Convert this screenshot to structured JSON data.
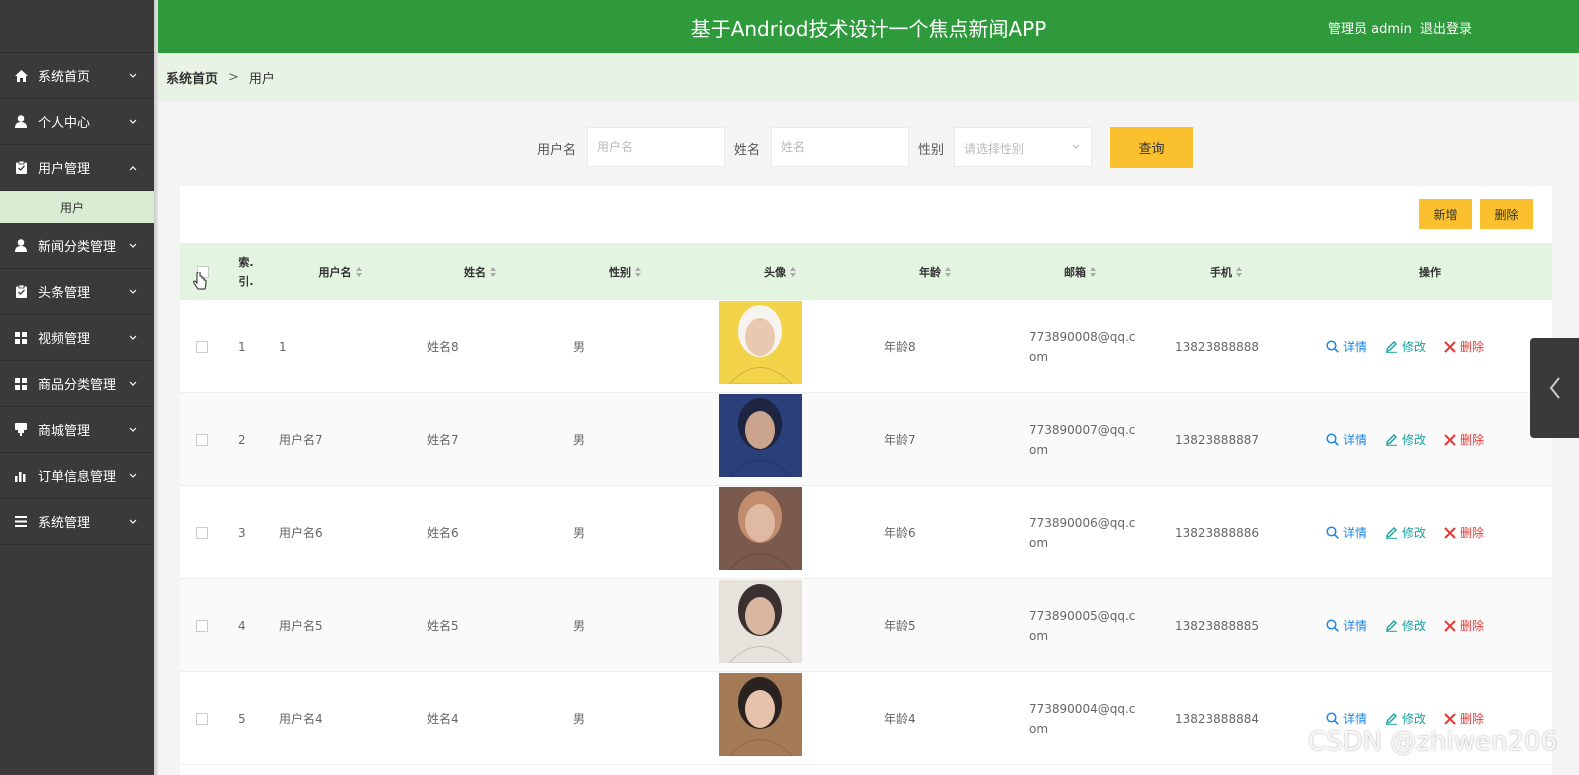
{
  "header": {
    "title": "基于Andriod技术设计一个焦点新闻APP",
    "admin_label": "管理员 admin",
    "logout_label": "退出登录"
  },
  "sidebar": {
    "items": [
      {
        "label": "系统首页",
        "icon": "home-icon"
      },
      {
        "label": "个人中心",
        "icon": "person-icon"
      },
      {
        "label": "用户管理",
        "icon": "clipboard-icon",
        "expanded": true
      },
      {
        "label": "新闻分类管理",
        "icon": "person-icon"
      },
      {
        "label": "头条管理",
        "icon": "clipboard-icon"
      },
      {
        "label": "视频管理",
        "icon": "grid-icon"
      },
      {
        "label": "商品分类管理",
        "icon": "grid-icon"
      },
      {
        "label": "商城管理",
        "icon": "flag-icon"
      },
      {
        "label": "订单信息管理",
        "icon": "bar-chart-icon"
      },
      {
        "label": "系统管理",
        "icon": "list-icon"
      }
    ],
    "sub_item": "用户"
  },
  "breadcrumb": {
    "home": "系统首页",
    "separator": ">",
    "current": "用户"
  },
  "search": {
    "username_label": "用户名",
    "username_placeholder": "用户名",
    "name_label": "姓名",
    "name_placeholder": "姓名",
    "gender_label": "性别",
    "gender_placeholder": "请选择性别",
    "query_label": "查询"
  },
  "toolbar": {
    "add_label": "新增",
    "delete_label": "删除"
  },
  "table": {
    "columns": {
      "index": "索.引.",
      "username": "用户名",
      "name": "姓名",
      "gender": "性别",
      "avatar": "头像",
      "age": "年龄",
      "email": "邮箱",
      "phone": "手机",
      "actions": "操作"
    },
    "actions": {
      "detail": "详情",
      "edit": "修改",
      "delete": "删除"
    },
    "rows": [
      {
        "index": "1",
        "username": "1",
        "name": "姓名8",
        "gender": "男",
        "age": "年龄8",
        "email": "773890008@qq.com",
        "phone": "13823888888"
      },
      {
        "index": "2",
        "username": "用户名7",
        "name": "姓名7",
        "gender": "男",
        "age": "年龄7",
        "email": "773890007@qq.com",
        "phone": "13823888887"
      },
      {
        "index": "3",
        "username": "用户名6",
        "name": "姓名6",
        "gender": "男",
        "age": "年龄6",
        "email": "773890006@qq.com",
        "phone": "13823888886"
      },
      {
        "index": "4",
        "username": "用户名5",
        "name": "姓名5",
        "gender": "男",
        "age": "年龄5",
        "email": "773890005@qq.com",
        "phone": "13823888885"
      },
      {
        "index": "5",
        "username": "用户名4",
        "name": "姓名4",
        "gender": "男",
        "age": "年龄4",
        "email": "773890004@qq.com",
        "phone": "13823888884"
      }
    ]
  },
  "watermark": "CSDN @zhiwen206",
  "colors": {
    "header_green": "#2e9a3b",
    "sidebar_dark": "#3a3a3a",
    "accent_yellow": "#fbc02d",
    "detail_blue": "#1e88e5",
    "edit_teal": "#17a2a2",
    "delete_red": "#e53935"
  }
}
